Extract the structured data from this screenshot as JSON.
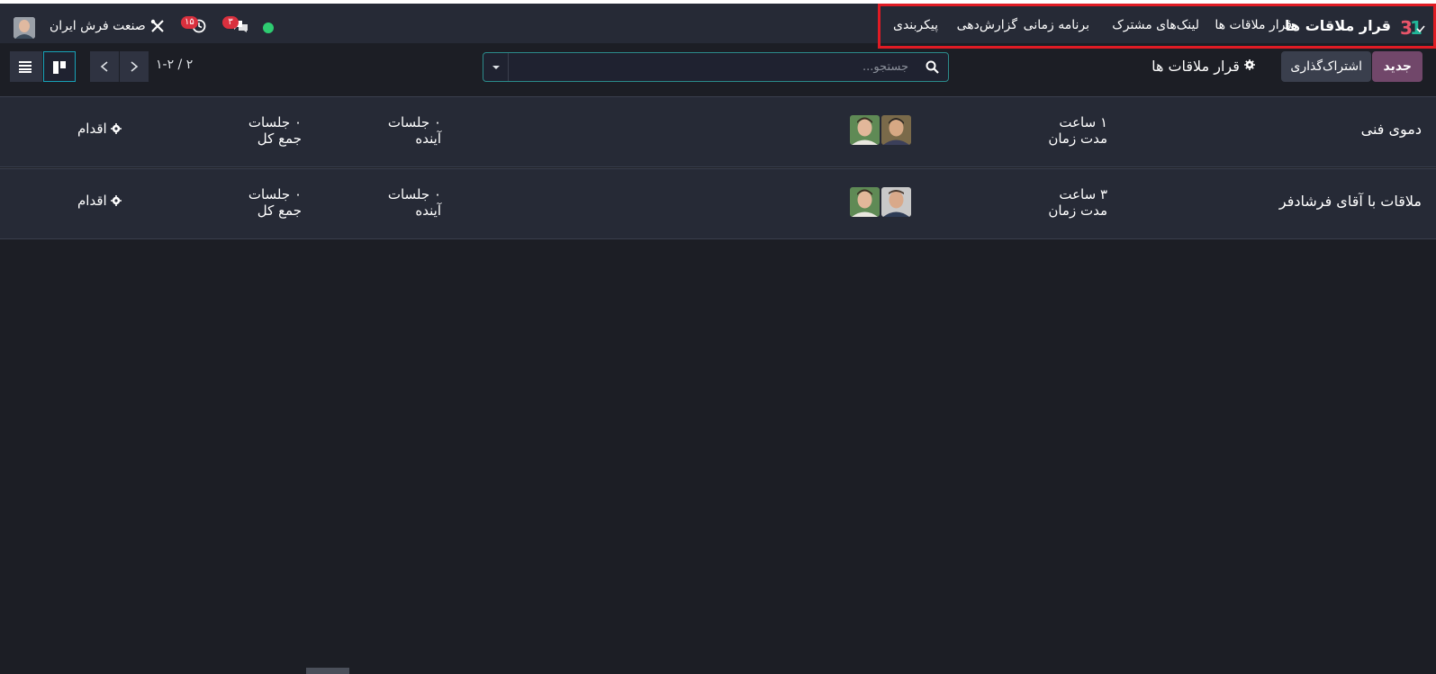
{
  "navbar": {
    "app_title": "قرار ملاقات ها",
    "menu": [
      "قرار ملاقات ها",
      "لینک‌های مشترک",
      "برنامه زمانی",
      "گزارش‌دهی",
      "پیکربندی"
    ],
    "company": "صنعت فرش ایران",
    "activity_badge": "۱۵",
    "chat_badge": "۳",
    "status_color": "#2ecc71"
  },
  "control": {
    "new_label": "جدید",
    "share_label": "اشتراک‌گذاری",
    "breadcrumb": "قرار ملاقات ها",
    "search_placeholder": "جستجو...",
    "pager": "۱-۲ / ۲"
  },
  "rows": [
    {
      "name": "دموی فنی",
      "duration_value": "۱ ساعت",
      "duration_label": "مدت زمان",
      "upcoming_value": "۰ جلسات",
      "upcoming_label": "آینده",
      "total_value": "۰ جلسات",
      "total_label": "جمع کل",
      "action": "اقدام"
    },
    {
      "name": "ملاقات با آقای فرشادفر",
      "duration_value": "۳ ساعت",
      "duration_label": "مدت زمان",
      "upcoming_value": "۰ جلسات",
      "upcoming_label": "آینده",
      "total_value": "۰ جلسات",
      "total_label": "جمع کل",
      "action": "اقدام"
    }
  ],
  "colors": {
    "accent": "#71476a",
    "highlight_box": "#e01b24",
    "badge": "#d9303e"
  }
}
